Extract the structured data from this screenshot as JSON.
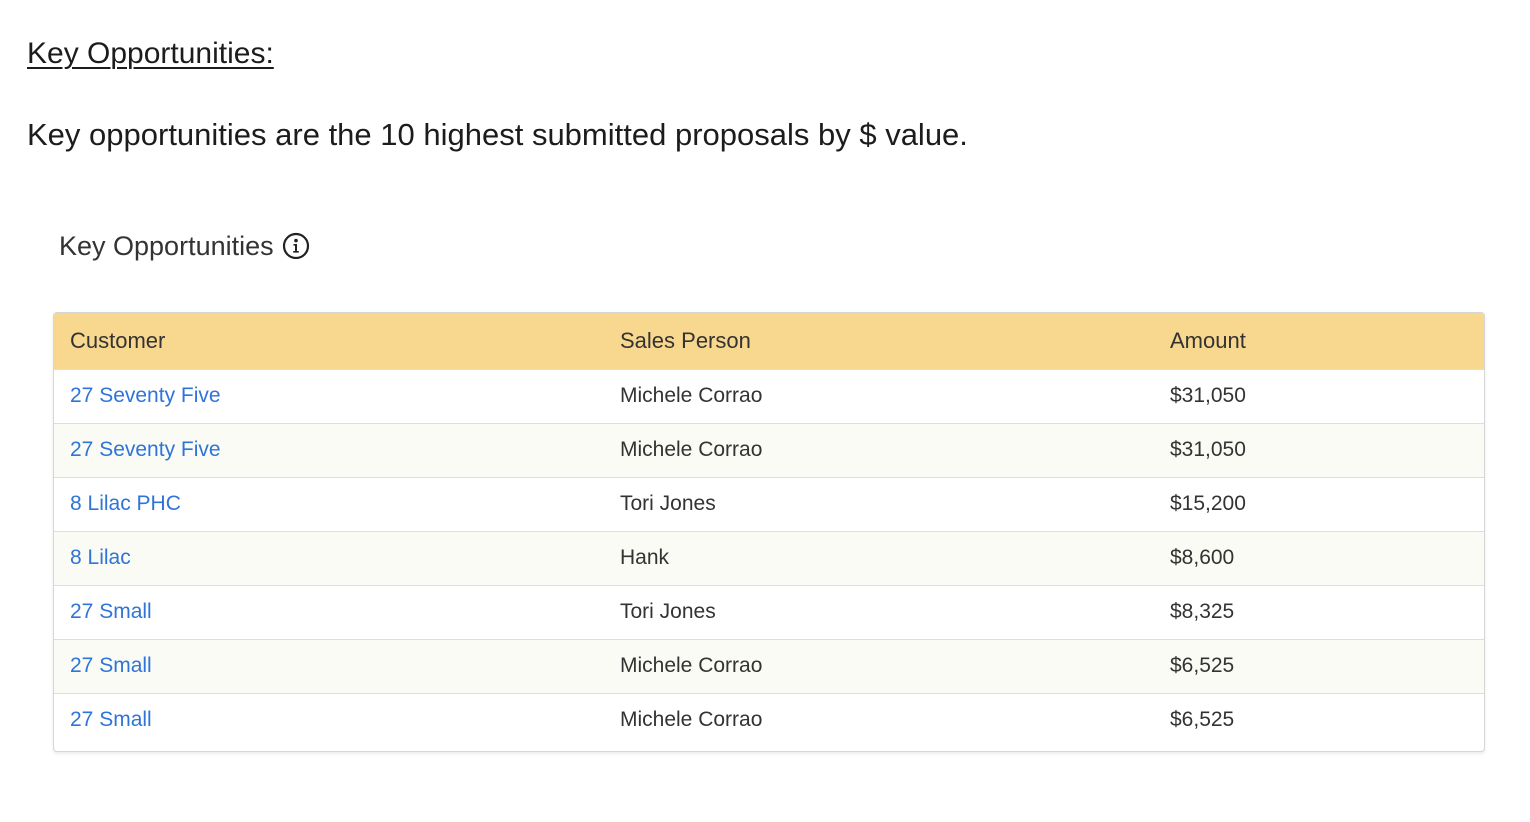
{
  "document": {
    "heading": "Key Opportunities:",
    "paragraph": "Key opportunities are the 10 highest submitted proposals by $ value."
  },
  "widget": {
    "title": "Key Opportunities",
    "info_icon": "info-circle-icon",
    "header_color": "#f8d78e",
    "link_color": "#2f74d8",
    "columns": [
      "Customer",
      "Sales Person",
      "Amount"
    ],
    "rows": [
      {
        "customer": "27 Seventy Five",
        "sales_person": "Michele Corrao",
        "amount": "$31,050"
      },
      {
        "customer": "27 Seventy Five",
        "sales_person": "Michele Corrao",
        "amount": "$31,050"
      },
      {
        "customer": "8 Lilac PHC",
        "sales_person": "Tori Jones",
        "amount": "$15,200"
      },
      {
        "customer": "8 Lilac",
        "sales_person": "Hank",
        "amount": "$8,600"
      },
      {
        "customer": "27 Small",
        "sales_person": "Tori Jones",
        "amount": "$8,325"
      },
      {
        "customer": "27 Small",
        "sales_person": "Michele Corrao",
        "amount": "$6,525"
      },
      {
        "customer": "27 Small",
        "sales_person": "Michele Corrao",
        "amount": "$6,525"
      }
    ]
  }
}
